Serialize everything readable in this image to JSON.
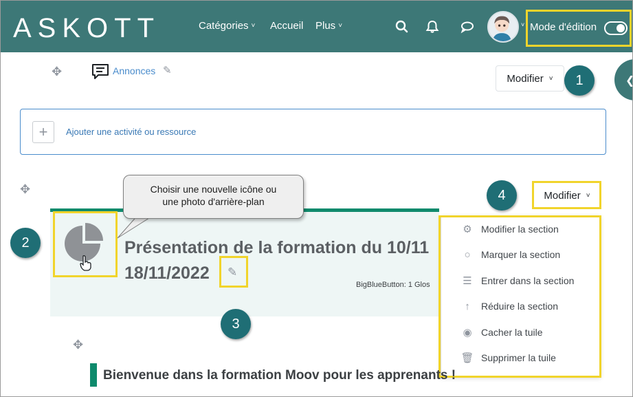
{
  "navbar": {
    "logo": "ASKOTT",
    "menu": [
      {
        "label": "Catégories",
        "has_dropdown": true
      },
      {
        "label": "Accueil",
        "has_dropdown": false
      },
      {
        "label": "Plus",
        "has_dropdown": true
      }
    ],
    "icons": [
      "search-icon",
      "bell-icon",
      "chat-bubble-icon"
    ],
    "edit_mode_label": "Mode d'édition",
    "edit_mode_on": true,
    "background_color": "#3d7877"
  },
  "announcements": {
    "label": "Annonces",
    "modify_label": "Modifier"
  },
  "add_activity": {
    "label": "Ajouter une activité ou ressource"
  },
  "tooltip": {
    "line1": "Choisir une nouvelle icône ou",
    "line2": "une photo d'arrière-plan"
  },
  "section": {
    "modify_label": "Modifier",
    "title": "Présentation de la formation du 10/11",
    "subtitle": "18/11/2022",
    "activity_summary": "BigBlueButton: 1 Glos",
    "accent_color": "#0e8a6c"
  },
  "section_menu": {
    "items": [
      {
        "label": "Modifier la section",
        "icon": "gear-icon"
      },
      {
        "label": "Marquer la section",
        "icon": "circle-icon"
      },
      {
        "label": "Entrer dans la section",
        "icon": "list-icon"
      },
      {
        "label": "Réduire la section",
        "icon": "arrow-up-icon"
      },
      {
        "label": "Cacher la tuile",
        "icon": "eye-icon"
      },
      {
        "label": "Supprimer la tuile",
        "icon": "trash-icon"
      }
    ]
  },
  "callouts": {
    "c1": "1",
    "c2": "2",
    "c3": "3",
    "c4": "4",
    "color": "#1f6e75"
  },
  "welcome": {
    "text": "Bienvenue dans la formation Moov pour les apprenants !"
  },
  "highlight_color": "#f1d42b"
}
